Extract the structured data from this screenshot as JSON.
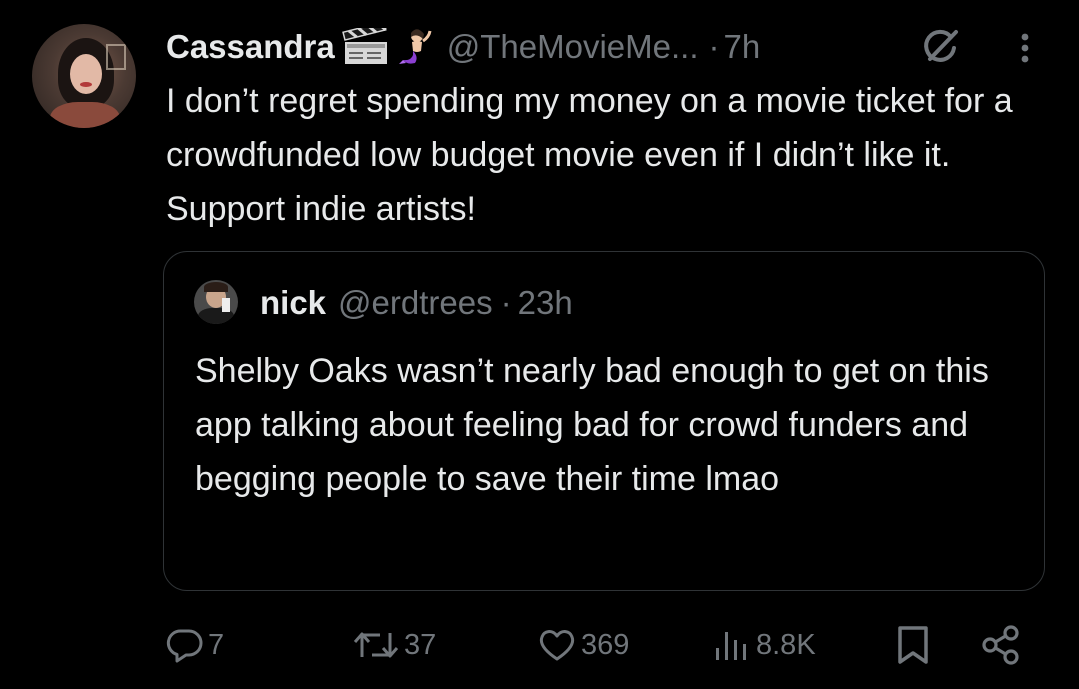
{
  "tweet": {
    "display_name": "Cassandra",
    "name_emojis": [
      "clapper-board",
      "mermaid"
    ],
    "handle": "@TheMovieMe...",
    "separator": "·",
    "time": "7h",
    "text": "I don’t regret spending my money on a movie ticket for a crowdfunded low budget movie even if I didn’t like it. Support indie artists!"
  },
  "quote": {
    "display_name": "nick",
    "handle": "@erdtrees",
    "separator": "·",
    "time": "23h",
    "text": "Shelby Oaks wasn’t nearly bad enough to get on this app talking about feeling bad for crowd funders and begging people to save their time lmao"
  },
  "actions": {
    "replies": "7",
    "reposts": "37",
    "likes": "369",
    "views": "8.8K"
  },
  "icons": {
    "grok": "grok-icon",
    "more": "more-icon",
    "reply": "reply-icon",
    "repost": "repost-icon",
    "like": "heart-icon",
    "views": "views-icon",
    "bookmark": "bookmark-icon",
    "share": "share-icon"
  },
  "colors": {
    "background": "#000000",
    "primary_text": "#e7e9ea",
    "secondary_text": "#71767b",
    "border": "#2f3336"
  }
}
